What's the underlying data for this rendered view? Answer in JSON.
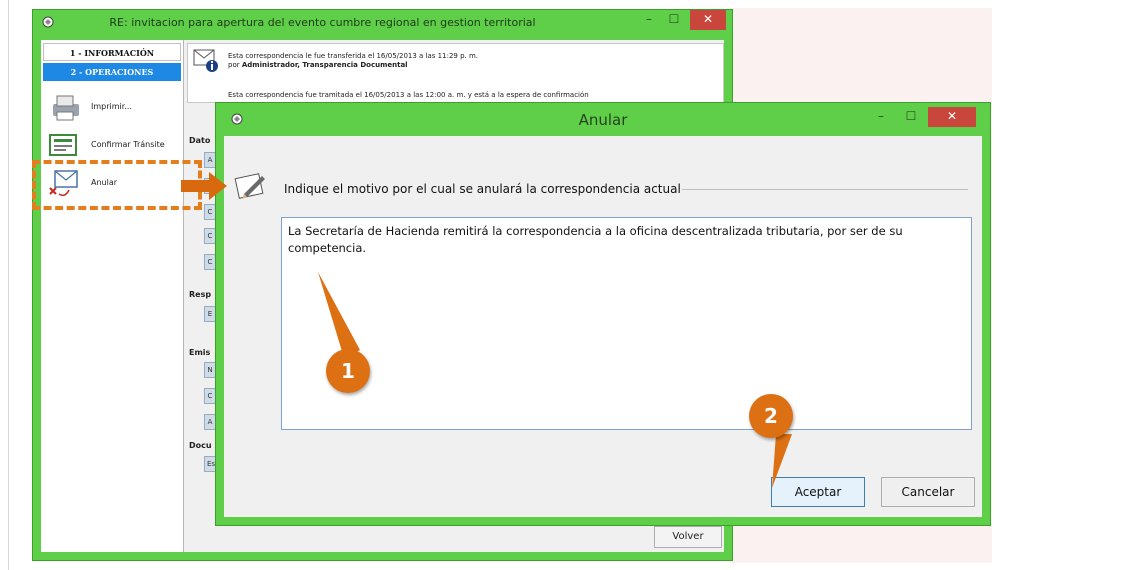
{
  "back_window": {
    "title": "RE: invitacion para apertura del evento cumbre regional en gestion territorial",
    "tabs": {
      "info": "1 - INFORMACIÓN",
      "ops": "2 - OPERACIONES"
    },
    "sidebar_items": [
      "Imprimir...",
      "Confirmar Tránsite",
      "Anular"
    ],
    "message": {
      "line1": "Esta correspondencia le fue transferida el 16/05/2013 a las 11:29 p. m.",
      "line2_prefix": "por ",
      "line2_bold": "Administrador, Transparencia Documental",
      "line3": "Esta correspondencia fue tramitada el 16/05/2013 a las 12:00 a. m. y está a la espera de confirmación"
    },
    "section_labels": [
      "Dato",
      "Resp",
      "Emis",
      "Docu"
    ],
    "chips": [
      "A",
      "C",
      "C",
      "C",
      "C",
      "E",
      "N",
      "C",
      "A",
      "Es"
    ],
    "volver_label": "Volver"
  },
  "dialog": {
    "title": "Anular",
    "prompt": "Indique el motivo por el cual se anulará la correspondencia actual",
    "textarea_value": "La Secretaría de Hacienda remitirá la correspondencia a la oficina descentralizada tributaria, por ser de su competencia.",
    "accept_label": "Aceptar",
    "cancel_label": "Cancelar"
  },
  "window_controls": {
    "minimize": "–",
    "maximize": "☐",
    "close": "✕"
  },
  "annotations": {
    "step1": "1",
    "step2": "2"
  },
  "colors": {
    "window_frame": "#5fcf4a",
    "close_button": "#c9463d",
    "annotation_orange": "#dd7013",
    "selected_tab": "#1e88e5"
  }
}
